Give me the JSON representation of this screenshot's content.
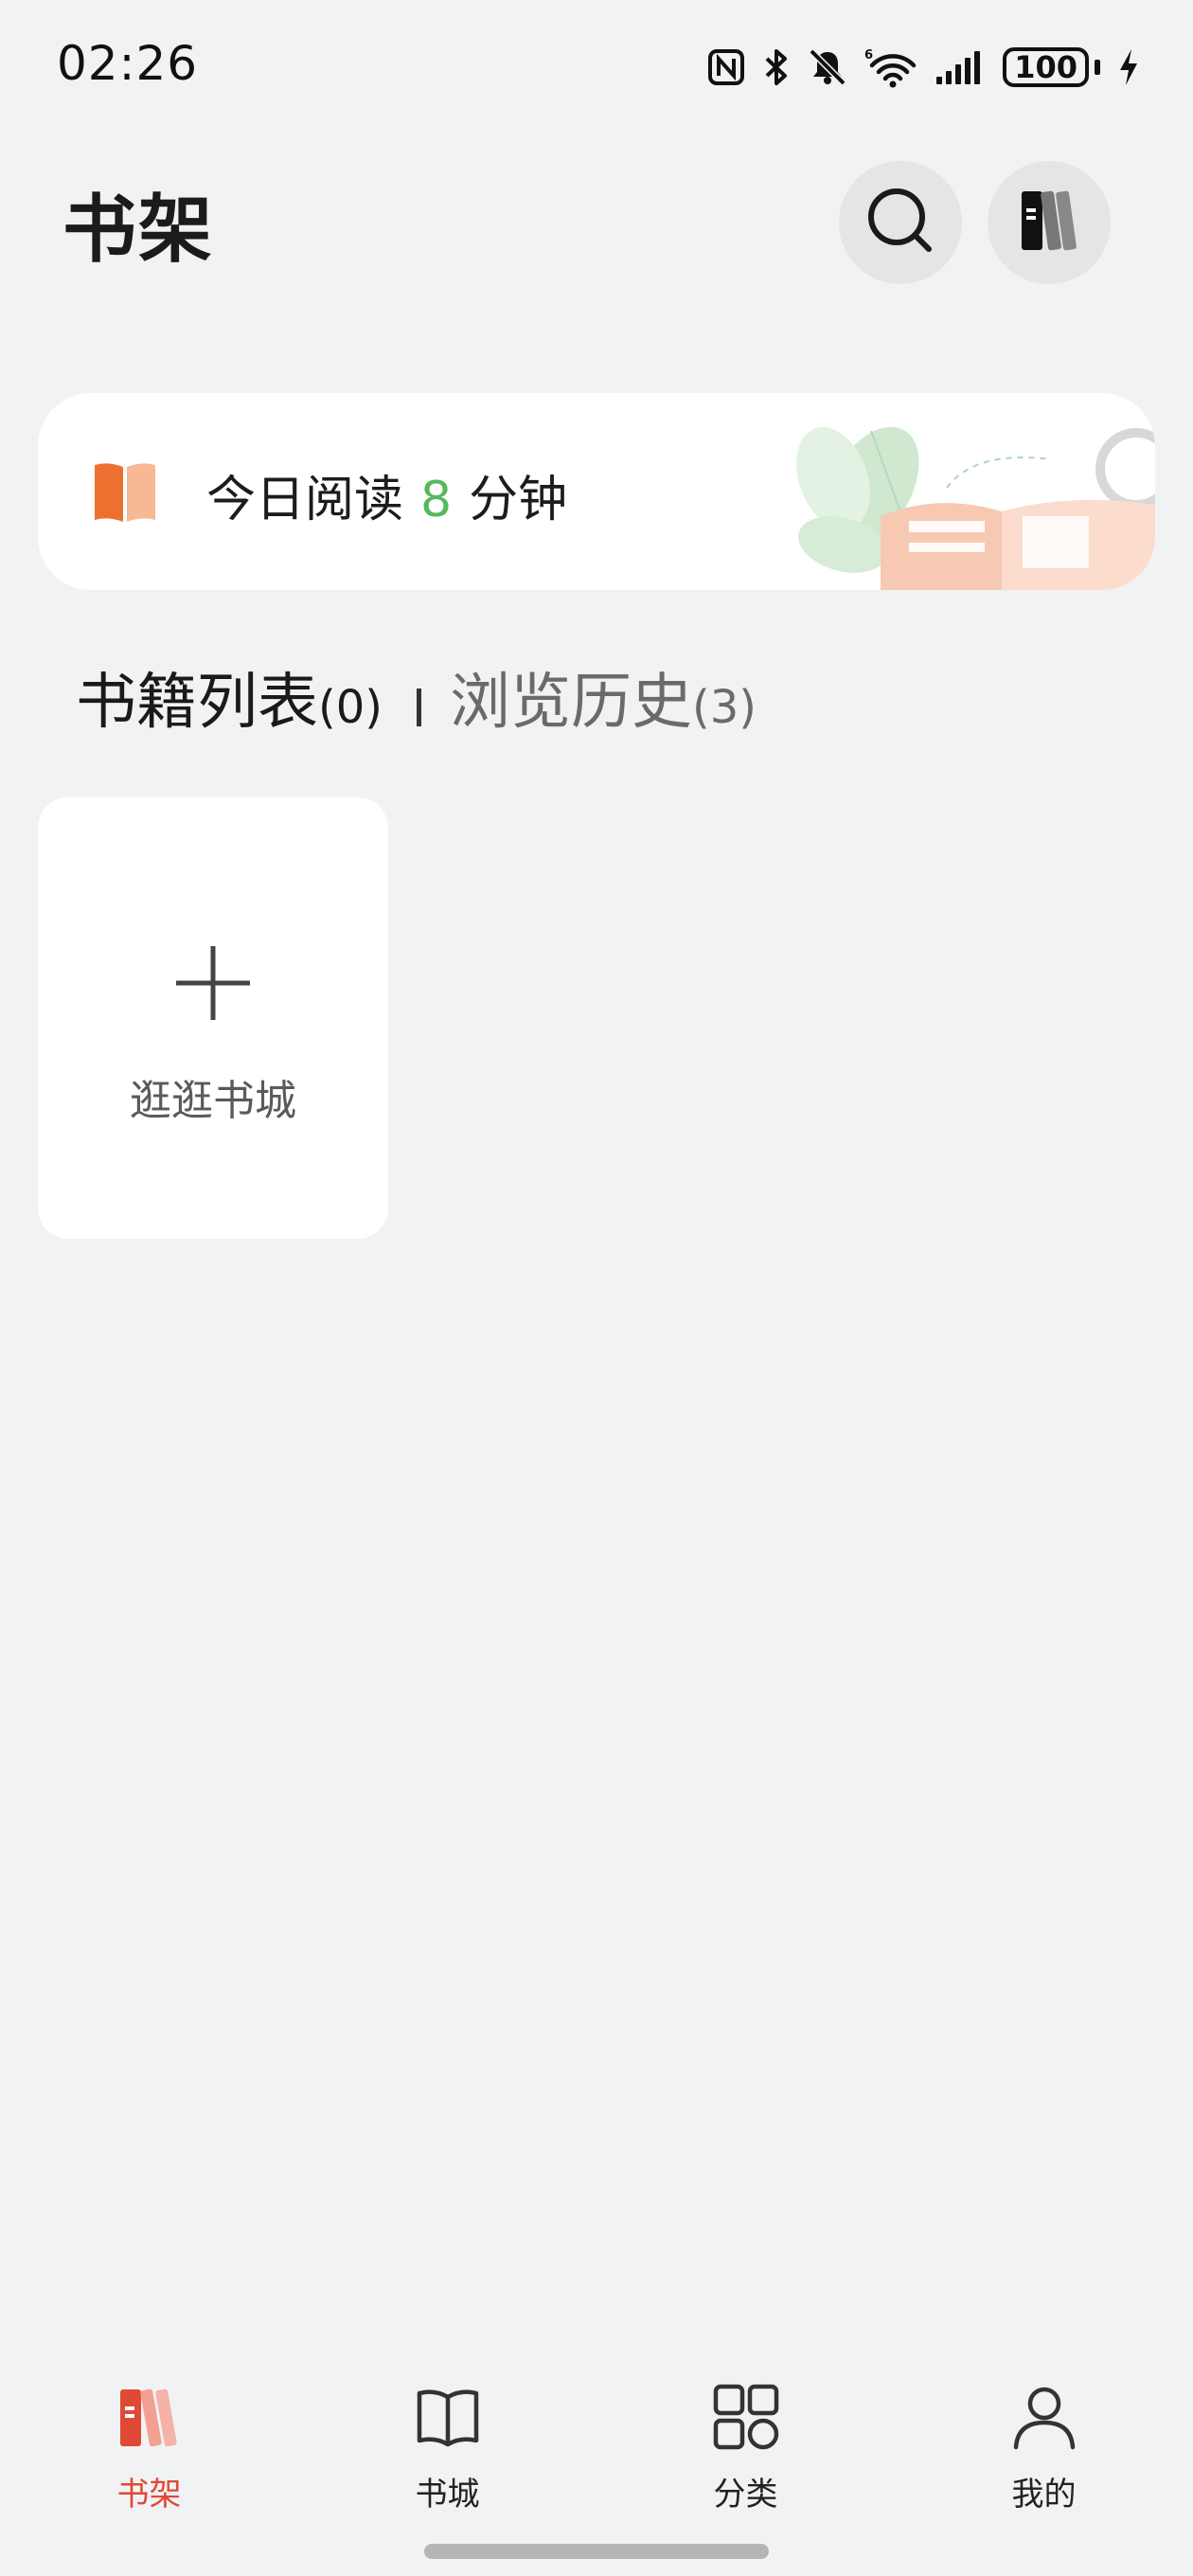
{
  "status_bar": {
    "time": "02:26",
    "battery": "100",
    "icons": [
      "nfc-icon",
      "bluetooth-icon",
      "mute-icon",
      "wifi-icon",
      "signal-icon",
      "battery-icon",
      "charging-icon"
    ]
  },
  "header": {
    "title": "书架",
    "search_icon": "search-icon",
    "manage_icon": "bookshelf-icon"
  },
  "reading_card": {
    "prefix": "今日阅读",
    "minutes": "8",
    "suffix": "分钟",
    "accent_color": "#56b85c"
  },
  "tabs": [
    {
      "label": "书籍列表",
      "count": "(0)",
      "active": true
    },
    {
      "label": "浏览历史",
      "count": "(3)",
      "active": false
    }
  ],
  "add_tile": {
    "label": "逛逛书城",
    "icon": "plus-icon"
  },
  "bottom_nav": {
    "active_color": "#e04a34",
    "items": [
      {
        "label": "书架",
        "icon": "bookshelf-icon",
        "active": true
      },
      {
        "label": "书城",
        "icon": "open-book-icon",
        "active": false
      },
      {
        "label": "分类",
        "icon": "grid-icon",
        "active": false
      },
      {
        "label": "我的",
        "icon": "person-icon",
        "active": false
      }
    ]
  }
}
